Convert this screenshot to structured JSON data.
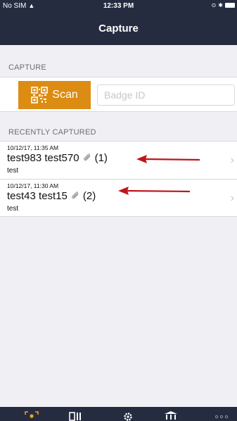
{
  "status_bar": {
    "carrier": "No SIM",
    "time": "12:33 PM"
  },
  "nav": {
    "title": "Capture"
  },
  "capture_section": {
    "header": "CAPTURE",
    "scan_label": "Scan",
    "badge_placeholder": "Badge ID"
  },
  "recent_section": {
    "header": "RECENTLY CAPTURED",
    "items": [
      {
        "timestamp": "10/12/17, 11:35 AM",
        "name": "test983 test570",
        "attachments": "(1)",
        "subtitle": "test"
      },
      {
        "timestamp": "10/12/17, 11:30 AM",
        "name": "test43 test15",
        "attachments": "(2)",
        "subtitle": "test"
      }
    ]
  },
  "tab_bar": {
    "tabs": [
      "capture-tab",
      "leads-tab",
      "settings-tab",
      "event-tab",
      "more-tab"
    ]
  },
  "colors": {
    "nav_background": "#262c40",
    "scan_button": "#dc8c12",
    "annotation_arrow": "#c0141a",
    "page_background": "#efeff4"
  }
}
